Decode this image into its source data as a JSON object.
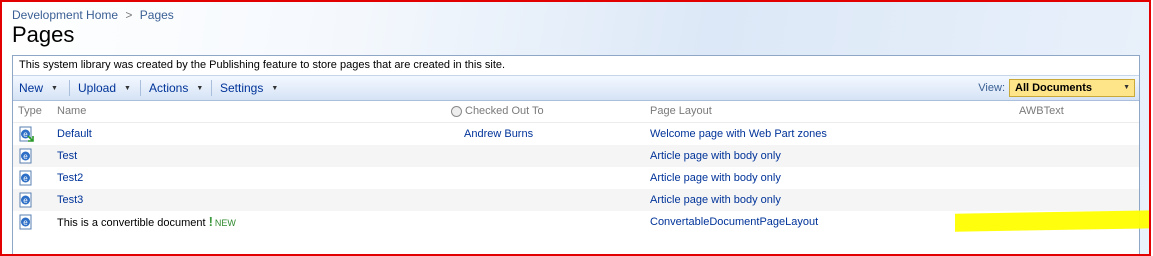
{
  "breadcrumb": {
    "home": "Development Home",
    "separator": ">",
    "current": "Pages"
  },
  "page_title": "Pages",
  "description": "This system library was created by the Publishing feature to store pages that are created in this site.",
  "toolbar": {
    "new_label": "New",
    "upload_label": "Upload",
    "actions_label": "Actions",
    "settings_label": "Settings",
    "view_label": "View:",
    "view_value": "All Documents"
  },
  "columns": {
    "type": "Type",
    "name": "Name",
    "checked_out_to": "Checked Out To",
    "page_layout": "Page Layout",
    "awbtext": "AWBText"
  },
  "rows": [
    {
      "name": "Default",
      "checked_out_to": "Andrew Burns",
      "page_layout": "Welcome page with Web Part zones",
      "icon": "checked-out-page-icon"
    },
    {
      "name": "Test",
      "checked_out_to": "",
      "page_layout": "Article page with body only",
      "icon": "page-icon"
    },
    {
      "name": "Test2",
      "checked_out_to": "",
      "page_layout": "Article page with body only",
      "icon": "page-icon"
    },
    {
      "name": "Test3",
      "checked_out_to": "",
      "page_layout": "Article page with body only",
      "icon": "page-icon"
    },
    {
      "name": "This is a convertible document",
      "checked_out_to": "",
      "page_layout": "ConvertableDocumentPageLayout",
      "icon": "page-icon",
      "new_badge": "NEW",
      "new_mark": "!"
    }
  ],
  "colors": {
    "frame_border": "#e30000",
    "link": "#003399",
    "view_select_bg": "#ffe58a",
    "highlight": "#ffff00"
  }
}
